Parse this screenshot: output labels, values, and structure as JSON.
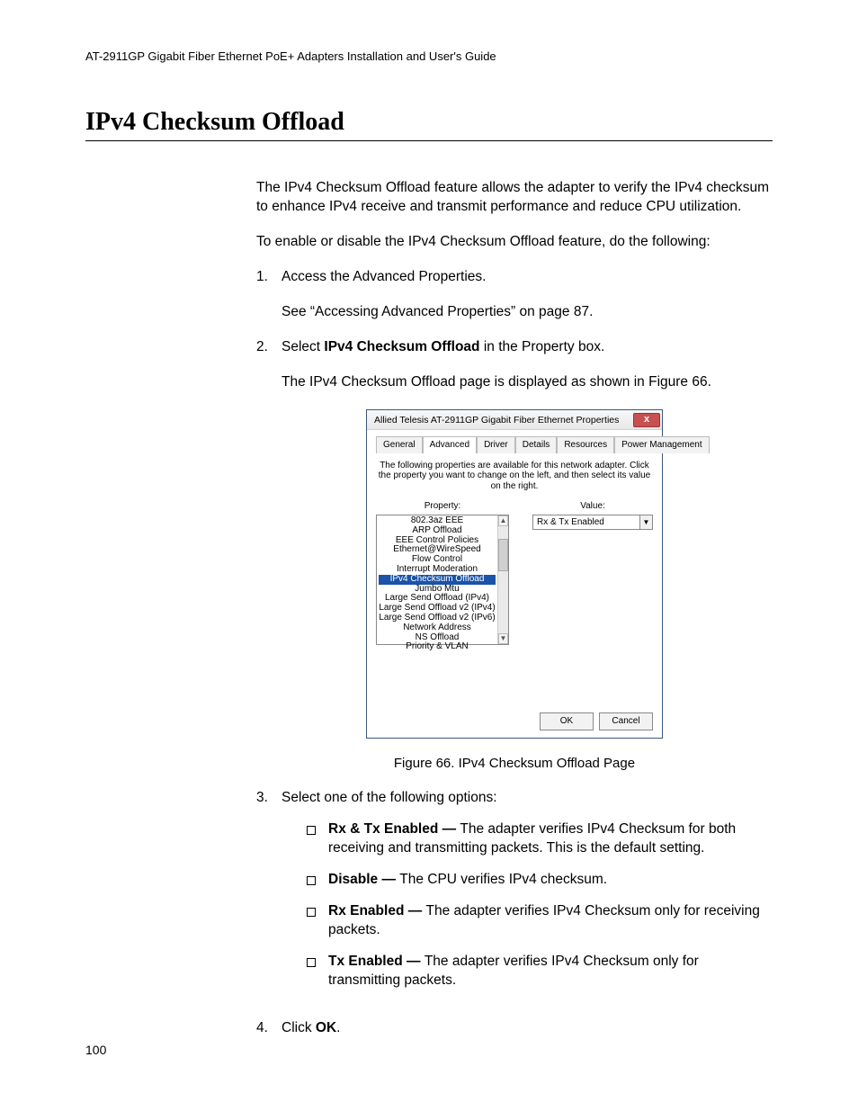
{
  "header": "AT-2911GP Gigabit Fiber Ethernet PoE+ Adapters Installation and User's Guide",
  "title": "IPv4 Checksum Offload",
  "intro": "The IPv4 Checksum Offload feature allows the adapter to verify the IPv4 checksum to enhance IPv4 receive and transmit performance and reduce CPU utilization.",
  "lead": "To enable or disable the IPv4 Checksum Offload feature, do the following:",
  "steps": {
    "s1": {
      "num": "1.",
      "text": "Access the Advanced Properties.",
      "sub": "See “Accessing Advanced Properties” on page 87."
    },
    "s2": {
      "num": "2.",
      "pre": "Select ",
      "bold": "IPv4 Checksum Offload",
      "post": " in the Property box.",
      "sub": "The IPv4 Checksum Offload page is displayed as shown in Figure 66."
    },
    "s3": {
      "num": "3.",
      "text": "Select one of the following options:"
    },
    "s4": {
      "num": "4.",
      "pre": "Click ",
      "bold": "OK",
      "post": "."
    }
  },
  "options": {
    "o1": {
      "bold": "Rx & Tx Enabled — ",
      "text": "The adapter verifies IPv4 Checksum for both receiving and transmitting packets. This is the default setting."
    },
    "o2": {
      "bold": "Disable — ",
      "text": "The CPU verifies IPv4 checksum."
    },
    "o3": {
      "bold": "Rx Enabled — ",
      "text": "The adapter verifies IPv4 Checksum only for receiving packets."
    },
    "o4": {
      "bold": "Tx Enabled — ",
      "text": "The adapter verifies IPv4 Checksum only for transmitting packets."
    }
  },
  "figure_caption": "Figure 66. IPv4 Checksum Offload Page",
  "page_number": "100",
  "dialog": {
    "title": "Allied Telesis AT-2911GP Gigabit Fiber Ethernet Properties",
    "close": "x",
    "tabs": {
      "general": "General",
      "advanced": "Advanced",
      "driver": "Driver",
      "details": "Details",
      "resources": "Resources",
      "power": "Power Management"
    },
    "desc": "The following properties are available for this network adapter. Click the property you want to change on the left, and then select its value on the right.",
    "property_label": "Property:",
    "value_label": "Value:",
    "properties": {
      "p0": "802.3az EEE",
      "p1": "ARP Offload",
      "p2": "EEE Control Policies",
      "p3": "Ethernet@WireSpeed",
      "p4": "Flow Control",
      "p5": "Interrupt Moderation",
      "p6": "IPv4 Checksum Offload",
      "p7": "Jumbo Mtu",
      "p8": "Large Send Offload (IPv4)",
      "p9": "Large Send Offload v2 (IPv4)",
      "p10": "Large Send Offload v2 (IPv6)",
      "p11": "Network Address",
      "p12": "NS Offload",
      "p13": "Priority & VLAN"
    },
    "value": "Rx & Tx Enabled",
    "ok": "OK",
    "cancel": "Cancel",
    "up": "▲",
    "down": "▼",
    "dd": "▼"
  }
}
